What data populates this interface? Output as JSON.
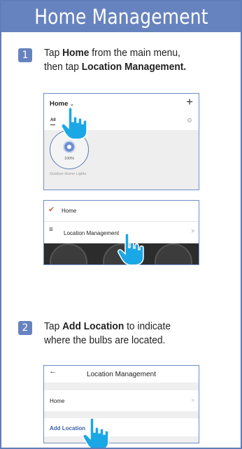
{
  "header": {
    "title": "Home Management"
  },
  "step1": {
    "number": "1",
    "line1_prefix": "Tap ",
    "line1_bold": "Home",
    "line1_suffix": " from the main menu,",
    "line2_prefix": "then tap ",
    "line2_bold": "Location Management."
  },
  "screen1": {
    "home_label": "Home",
    "plus": "+",
    "tab_all": "All",
    "device_percent": "100%",
    "device_label": "Outdoor Home Lights"
  },
  "screen2": {
    "home_item": "Home",
    "location_item": "Location Management",
    "chevron": ">"
  },
  "step2": {
    "number": "2",
    "line1_prefix": "Tap ",
    "line1_bold": "Add Location",
    "line1_suffix": " to indicate",
    "line2": "where the bulbs are located."
  },
  "screen3": {
    "back": "←",
    "title": "Location Management",
    "home_item": "Home",
    "add_item": "Add Location",
    "chevron": ">"
  },
  "colors": {
    "header_bg": "#6783bf",
    "accent_blue": "#3f62a8",
    "check_red": "#e55b3c",
    "hand_blue": "#1aa7e6"
  }
}
